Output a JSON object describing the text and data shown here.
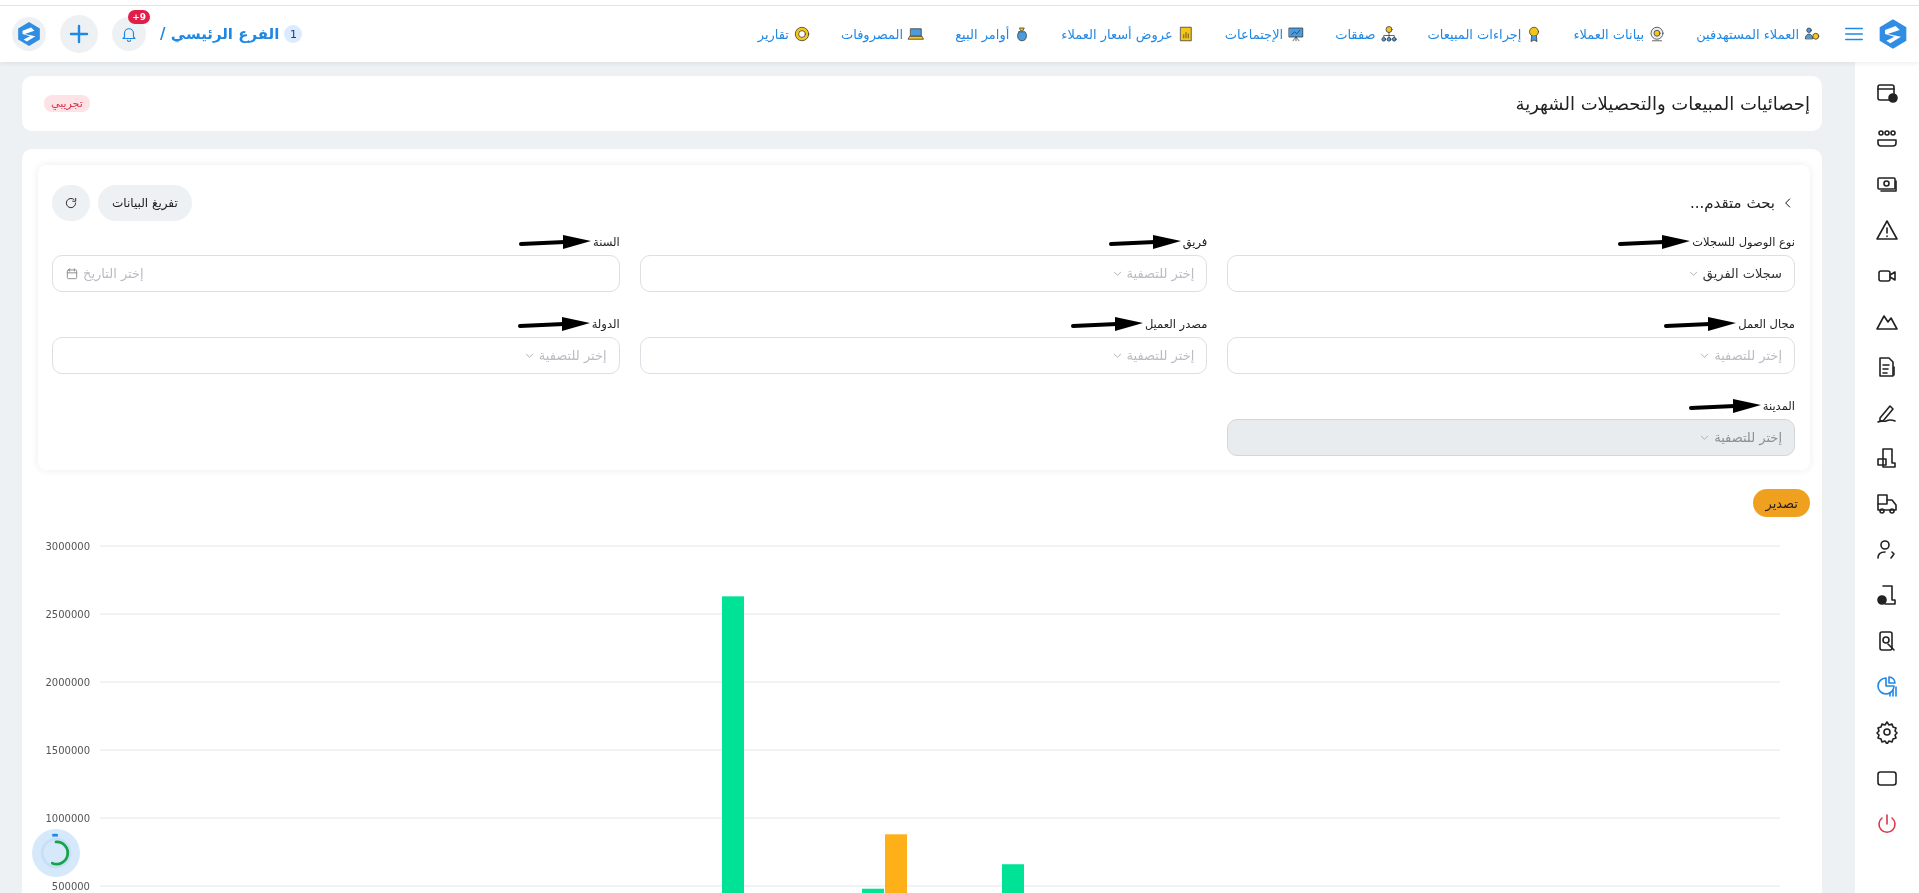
{
  "top_bar": {
    "nav_items": [
      {
        "label": "العملاء المستهدفين"
      },
      {
        "label": "بيانات العملاء"
      },
      {
        "label": "إجراءات المبيعات"
      },
      {
        "label": "صفقات"
      },
      {
        "label": "الإجتماعات"
      },
      {
        "label": "عروض أسعار العملاء"
      },
      {
        "label": "أوامر البيع"
      },
      {
        "label": "المصروفات"
      },
      {
        "label": "تقارير"
      }
    ],
    "branch": {
      "number": "1",
      "label": "الفرع الرئيسي /"
    },
    "notification_badge": "+9"
  },
  "sidebar": {
    "items": [
      {
        "selected": false
      },
      {
        "selected": false
      },
      {
        "selected": false
      },
      {
        "selected": false
      },
      {
        "selected": false
      },
      {
        "selected": false
      },
      {
        "selected": false
      },
      {
        "selected": false
      },
      {
        "selected": false
      },
      {
        "selected": false
      },
      {
        "selected": false
      },
      {
        "selected": false
      },
      {
        "selected": false
      },
      {
        "selected": true
      },
      {
        "selected": false
      },
      {
        "selected": false
      },
      {
        "selected": false
      }
    ]
  },
  "page_header": {
    "title": "إحصائيات المبيعات والتحصيلات الشهرية",
    "badge": "تجريبي"
  },
  "filters": {
    "title": "بحث متقدم...",
    "buttons": [
      "تفريغ البيانات"
    ],
    "fields": [
      {
        "kind": "select",
        "label": "نوع الوصول للسجلات",
        "value": "سجلات الفريق",
        "disabled": false
      },
      {
        "kind": "select",
        "label": "فريق",
        "placeholder": "إختر للتصفية",
        "disabled": false
      },
      {
        "kind": "date",
        "label": "السنة",
        "placeholder": "إختر التاريخ",
        "disabled": false
      },
      {
        "kind": "select",
        "label": "مجال العمل",
        "placeholder": "إختر للتصفية",
        "disabled": false
      },
      {
        "kind": "select",
        "label": "مصدر العميل",
        "placeholder": "إختر للتصفية",
        "disabled": false
      },
      {
        "kind": "select",
        "label": "الدولة",
        "placeholder": "إختر للتصفية",
        "disabled": false
      },
      {
        "kind": "select",
        "label": "المدينة",
        "placeholder": "إختر للتصفية",
        "disabled": true
      }
    ]
  },
  "export_button": "تصدير",
  "chart": {
    "chart_data": {
      "type": "bar",
      "ylim": [
        0,
        3000000
      ],
      "stacked": false,
      "grid": true,
      "yticks": [
        500000,
        1000000,
        1500000,
        2000000,
        2500000,
        3000000
      ],
      "series": [
        {
          "color": "#00e396",
          "values": [
            null,
            null,
            null,
            null,
            2630000,
            480000,
            660000,
            null,
            null,
            null,
            null,
            null
          ]
        },
        {
          "color": "#feb019",
          "values": [
            null,
            null,
            null,
            null,
            null,
            880000,
            null,
            null,
            null,
            null,
            null,
            null
          ]
        }
      ]
    }
  }
}
